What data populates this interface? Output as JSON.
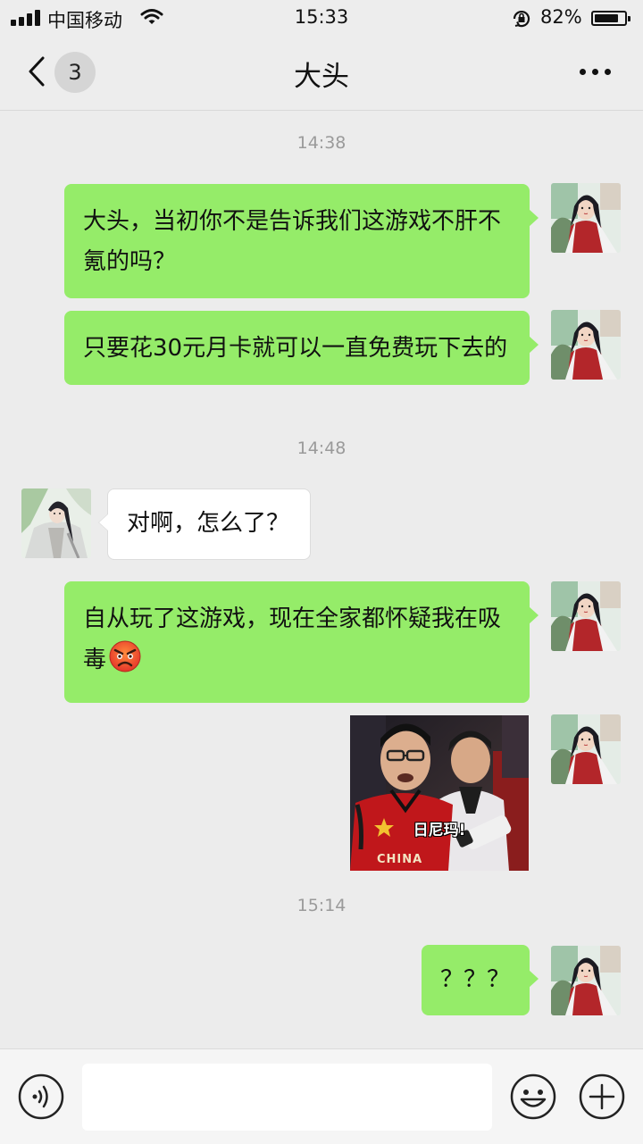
{
  "status_bar": {
    "carrier": "中国移动",
    "time": "15:33",
    "battery": "82%",
    "battery_level": 0.82,
    "icons": [
      "signal-icon",
      "wifi-icon",
      "rotation-lock-icon",
      "battery-icon"
    ]
  },
  "header": {
    "unread_count": "3",
    "title": "大头",
    "icons": [
      "chevron-left-icon",
      "more-icon"
    ]
  },
  "messages": [
    {
      "type": "timestamp",
      "text": "14:38"
    },
    {
      "type": "text",
      "from": "me",
      "text": "大头，当初你不是告诉我们这游戏不肝不氪的吗？"
    },
    {
      "type": "text",
      "from": "me",
      "text": "只要花30元月卡就可以一直免费玩下去的"
    },
    {
      "type": "timestamp",
      "text": "14:48"
    },
    {
      "type": "text",
      "from": "other",
      "text": "对啊，怎么了？"
    },
    {
      "type": "text",
      "from": "me",
      "text": "自从玩了这游戏，现在全家都怀疑我在吸毒",
      "emoji": "angry-face-icon"
    },
    {
      "type": "image",
      "from": "me",
      "caption": "日尼玛!",
      "shirt_text": "CHINA"
    },
    {
      "type": "timestamp",
      "text": "15:14"
    },
    {
      "type": "text",
      "from": "me",
      "text": "？？？"
    }
  ],
  "input_bar": {
    "placeholder": "",
    "icons": [
      "voice-icon",
      "emoji-icon",
      "plus-icon"
    ]
  },
  "colors": {
    "my_bubble": "#95ec69",
    "other_bubble": "#ffffff",
    "background": "#ececec",
    "timestamp": "#9a9a9a"
  }
}
